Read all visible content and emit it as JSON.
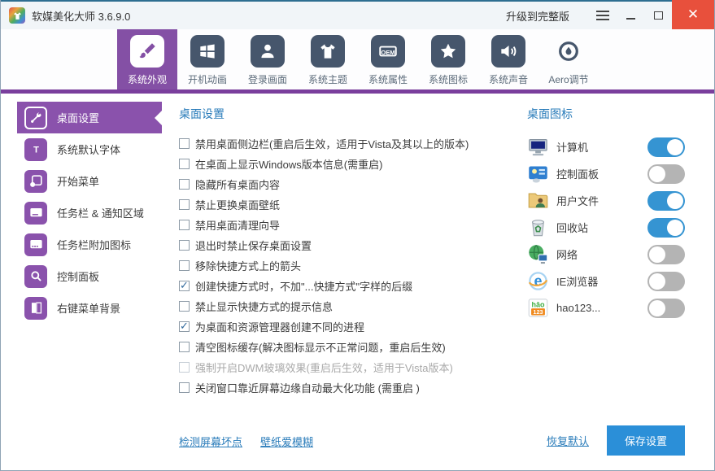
{
  "window": {
    "title": "软媒美化大师 3.6.9.0",
    "upgrade_label": "升级到完整版"
  },
  "nav": {
    "items": [
      {
        "label": "系统外观",
        "icon": "paintbrush-icon",
        "active": true
      },
      {
        "label": "开机动画",
        "icon": "windows-logo-icon",
        "active": false
      },
      {
        "label": "登录画面",
        "icon": "user-icon",
        "active": false
      },
      {
        "label": "系统主题",
        "icon": "tshirt-icon",
        "active": false
      },
      {
        "label": "系统属性",
        "icon": "oem-icon",
        "active": false
      },
      {
        "label": "系统图标",
        "icon": "star-icon",
        "active": false
      },
      {
        "label": "系统声音",
        "icon": "speaker-icon",
        "active": false
      },
      {
        "label": "Aero调节",
        "icon": "aero-drop-icon",
        "active": false
      }
    ]
  },
  "sidebar": {
    "items": [
      {
        "label": "桌面设置",
        "icon": "wrench-icon",
        "active": true
      },
      {
        "label": "系统默认字体",
        "icon": "font-icon",
        "active": false
      },
      {
        "label": "开始菜单",
        "icon": "start-menu-icon",
        "active": false
      },
      {
        "label": "任务栏 & 通知区域",
        "icon": "taskbar-icon",
        "active": false
      },
      {
        "label": "任务栏附加图标",
        "icon": "taskbar-extra-icon",
        "active": false
      },
      {
        "label": "控制面板",
        "icon": "magnifier-icon",
        "active": false
      },
      {
        "label": "右键菜单背景",
        "icon": "context-menu-icon",
        "active": false
      }
    ]
  },
  "main": {
    "heading": "桌面设置",
    "checkboxes": [
      {
        "label": "禁用桌面侧边栏(重启后生效，适用于Vista及其以上的版本)",
        "checked": false,
        "disabled": false
      },
      {
        "label": "在桌面上显示Windows版本信息(需重启)",
        "checked": false,
        "disabled": false
      },
      {
        "label": "隐藏所有桌面内容",
        "checked": false,
        "disabled": false
      },
      {
        "label": "禁止更换桌面壁纸",
        "checked": false,
        "disabled": false
      },
      {
        "label": "禁用桌面清理向导",
        "checked": false,
        "disabled": false
      },
      {
        "label": "退出时禁止保存桌面设置",
        "checked": false,
        "disabled": false
      },
      {
        "label": "移除快捷方式上的箭头",
        "checked": false,
        "disabled": false
      },
      {
        "label": "创建快捷方式时，不加\"...快捷方式\"字样的后缀",
        "checked": true,
        "disabled": false
      },
      {
        "label": "禁止显示快捷方式的提示信息",
        "checked": false,
        "disabled": false
      },
      {
        "label": "为桌面和资源管理器创建不同的进程",
        "checked": true,
        "disabled": false
      },
      {
        "label": "清空图标缓存(解决图标显示不正常问题，重启后生效)",
        "checked": false,
        "disabled": false
      },
      {
        "label": "强制开启DWM玻璃效果(重启后生效，适用于Vista版本)",
        "checked": false,
        "disabled": true
      },
      {
        "label": "关闭窗口靠近屏幕边缘自动最大化功能 (需重启 )",
        "checked": false,
        "disabled": false
      }
    ],
    "links": [
      {
        "label": "检测屏幕坏点"
      },
      {
        "label": "壁纸爱模糊"
      }
    ]
  },
  "icons_panel": {
    "heading": "桌面图标",
    "items": [
      {
        "label": "计算机",
        "icon": "computer-icon",
        "on": true
      },
      {
        "label": "控制面板",
        "icon": "control-panel-icon",
        "on": false
      },
      {
        "label": "用户文件",
        "icon": "user-files-icon",
        "on": true
      },
      {
        "label": "回收站",
        "icon": "recycle-bin-icon",
        "on": true
      },
      {
        "label": "网络",
        "icon": "network-icon",
        "on": false
      },
      {
        "label": "IE浏览器",
        "icon": "ie-icon",
        "on": false
      },
      {
        "label": "hao123...",
        "icon": "hao123-icon",
        "on": false
      }
    ],
    "restore_label": "恢复默认",
    "save_label": "保存设置"
  },
  "colors": {
    "accent_purple": "#8450a5",
    "nav_border_purple": "#7a3f9d",
    "heading_blue": "#2a7cba",
    "toggle_on_blue": "#3594d2",
    "toggle_off_gray": "#b4b4b4",
    "save_button_blue": "#2b8fd8",
    "close_red": "#e8503c",
    "titlebar_top_line": "#2e6e91",
    "nav_icon_slate": "#46566c"
  }
}
